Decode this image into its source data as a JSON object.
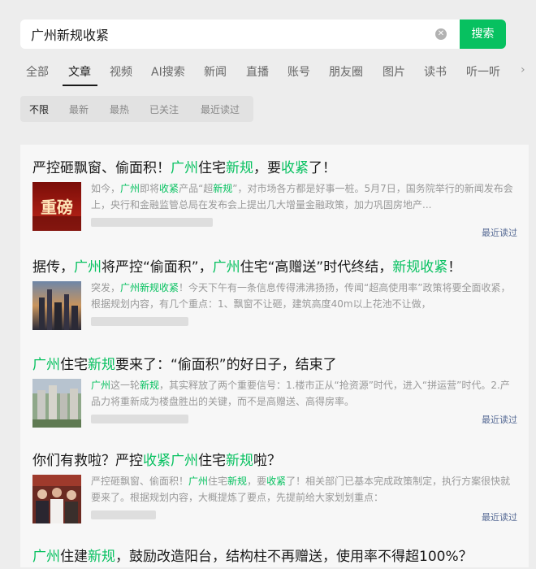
{
  "search": {
    "query": "广州新规收紧",
    "clear_icon": "clear-icon",
    "button_label": "搜索"
  },
  "tabs": [
    "全部",
    "文章",
    "视频",
    "AI搜索",
    "新闻",
    "直播",
    "账号",
    "朋友圈",
    "图片",
    "读书",
    "听一听"
  ],
  "tabs_active": "文章",
  "tabs_more_icon": "chevron-right-icon",
  "filters": [
    "不限",
    "最新",
    "最热",
    "已关注",
    "最近读过"
  ],
  "filters_active": "不限",
  "colors": {
    "accent": "#07c160",
    "link": "#576b95"
  },
  "results": [
    {
      "title": [
        {
          "t": "严控砸飘窗、偷面积！"
        },
        {
          "t": "广州",
          "hl": true
        },
        {
          "t": "住宅"
        },
        {
          "t": "新规",
          "hl": true
        },
        {
          "t": "，要"
        },
        {
          "t": "收紧",
          "hl": true
        },
        {
          "t": "了！"
        }
      ],
      "thumb_text": "重磅",
      "snippet": [
        {
          "t": "如今，"
        },
        {
          "t": "广州",
          "hl": true
        },
        {
          "t": "即将"
        },
        {
          "t": "收紧",
          "hl": true
        },
        {
          "t": "产品“超"
        },
        {
          "t": "新规",
          "hl": true
        },
        {
          "t": "”，对市场各方都是好事一桩。5月7日，国务院举行的新闻发布会上，央行和金融监管总局在发布会上提出几大增量金融政策，加力巩固房地产..."
        }
      ],
      "recent": "最近读过"
    },
    {
      "title": [
        {
          "t": "据传，"
        },
        {
          "t": "广州",
          "hl": true
        },
        {
          "t": "将严控“偷面积”，"
        },
        {
          "t": "广州",
          "hl": true
        },
        {
          "t": "住宅“高赠送”时代终结，"
        },
        {
          "t": "新规收紧",
          "hl": true
        },
        {
          "t": "！"
        }
      ],
      "snippet": [
        {
          "t": "突发，"
        },
        {
          "t": "广州新规收紧",
          "hl": true
        },
        {
          "t": "！今天下午有一条信息传得沸沸扬扬，传闻“超高使用率”政策将要全面收紧，根据规划内容，有几个重点：1、飘窗不让砸，建筑高度40m以上花池不让做，"
        }
      ],
      "recent": ""
    },
    {
      "title": [
        {
          "t": "广州",
          "hl": true
        },
        {
          "t": "住宅"
        },
        {
          "t": "新规",
          "hl": true
        },
        {
          "t": "要来了：“偷面积”的好日子，结束了"
        }
      ],
      "snippet": [
        {
          "t": "广州",
          "hl": true
        },
        {
          "t": "这一轮"
        },
        {
          "t": "新规",
          "hl": true
        },
        {
          "t": "，其实释放了两个重要信号：1.楼市正从“抢资源”时代，进入“拼运营”时代。2.产品力将重新成为楼盘胜出的关键，而不是高赠送、高得房率。"
        }
      ],
      "recent": "最近读过"
    },
    {
      "title": [
        {
          "t": "你们有救啦？严控"
        },
        {
          "t": "收紧广州",
          "hl": true
        },
        {
          "t": "住宅"
        },
        {
          "t": "新规",
          "hl": true
        },
        {
          "t": "啦？"
        }
      ],
      "snippet": [
        {
          "t": "严控砸飘窗、偷面积！"
        },
        {
          "t": "广州",
          "hl": true
        },
        {
          "t": "住宅"
        },
        {
          "t": "新规",
          "hl": true
        },
        {
          "t": "，要"
        },
        {
          "t": "收紧",
          "hl": true
        },
        {
          "t": "了！相关部门已基本完成政策制定，执行方案很快就要来了。根据规划内容，大概提炼了要点，先提前给大家划划重点："
        }
      ],
      "recent": "最近读过"
    },
    {
      "title": [
        {
          "t": "广州",
          "hl": true
        },
        {
          "t": "住建"
        },
        {
          "t": "新规",
          "hl": true
        },
        {
          "t": "，鼓励改造阳台，结构柱不再赠送，使用率不得超100%？"
        }
      ],
      "snippet": [],
      "recent": ""
    }
  ]
}
